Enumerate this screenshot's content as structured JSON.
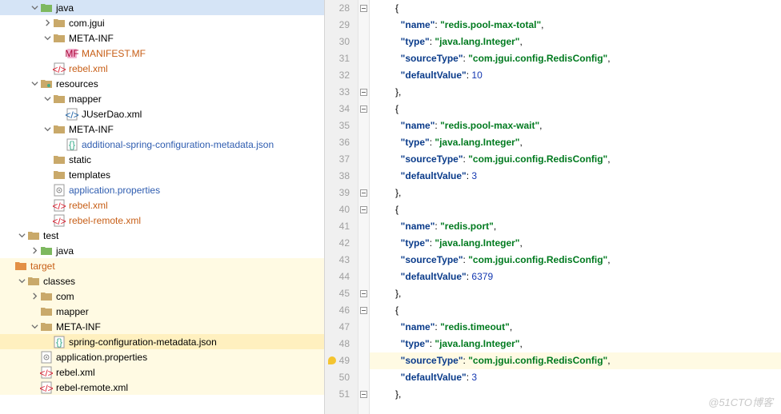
{
  "tree": [
    {
      "d": 2,
      "arr": "down",
      "icon": "folder-green",
      "label": "java",
      "cls": ""
    },
    {
      "d": 3,
      "arr": "right",
      "icon": "folder",
      "label": "com.jgui",
      "cls": ""
    },
    {
      "d": 3,
      "arr": "down",
      "icon": "folder",
      "label": "META-INF",
      "cls": ""
    },
    {
      "d": 4,
      "arr": "",
      "icon": "mf",
      "label": "MANIFEST.MF",
      "cls": "orange"
    },
    {
      "d": 3,
      "arr": "",
      "icon": "xml",
      "label": "rebel.xml",
      "cls": "orange"
    },
    {
      "d": 2,
      "arr": "down",
      "icon": "folder-res",
      "label": "resources",
      "cls": ""
    },
    {
      "d": 3,
      "arr": "down",
      "icon": "folder",
      "label": "mapper",
      "cls": ""
    },
    {
      "d": 4,
      "arr": "",
      "icon": "xml-b",
      "label": "JUserDao.xml",
      "cls": ""
    },
    {
      "d": 3,
      "arr": "down",
      "icon": "folder",
      "label": "META-INF",
      "cls": ""
    },
    {
      "d": 4,
      "arr": "",
      "icon": "json",
      "label": "additional-spring-configuration-metadata.json",
      "cls": "blue"
    },
    {
      "d": 3,
      "arr": "",
      "icon": "folder",
      "label": "static",
      "cls": ""
    },
    {
      "d": 3,
      "arr": "",
      "icon": "folder",
      "label": "templates",
      "cls": ""
    },
    {
      "d": 3,
      "arr": "",
      "icon": "props",
      "label": "application.properties",
      "cls": "blue"
    },
    {
      "d": 3,
      "arr": "",
      "icon": "xml",
      "label": "rebel.xml",
      "cls": "orange"
    },
    {
      "d": 3,
      "arr": "",
      "icon": "xml",
      "label": "rebel-remote.xml",
      "cls": "orange"
    },
    {
      "d": 1,
      "arr": "down",
      "icon": "folder",
      "label": "test",
      "cls": ""
    },
    {
      "d": 2,
      "arr": "right",
      "icon": "folder-green",
      "label": "java",
      "cls": ""
    },
    {
      "d": 0,
      "arr": "",
      "icon": "folder-out",
      "label": "target",
      "cls": "orange",
      "hl": true
    },
    {
      "d": 1,
      "arr": "down",
      "icon": "folder",
      "label": "classes",
      "cls": "",
      "hl": true
    },
    {
      "d": 2,
      "arr": "right",
      "icon": "folder",
      "label": "com",
      "cls": "",
      "hl": true
    },
    {
      "d": 2,
      "arr": "",
      "icon": "folder",
      "label": "mapper",
      "cls": "",
      "hl": true
    },
    {
      "d": 2,
      "arr": "down",
      "icon": "folder",
      "label": "META-INF",
      "cls": "",
      "hl": true
    },
    {
      "d": 3,
      "arr": "",
      "icon": "json",
      "label": "spring-configuration-metadata.json",
      "cls": "",
      "sel": true
    },
    {
      "d": 2,
      "arr": "",
      "icon": "props",
      "label": "application.properties",
      "cls": "",
      "hl": true
    },
    {
      "d": 2,
      "arr": "",
      "icon": "xml",
      "label": "rebel.xml",
      "cls": "",
      "hl": true
    },
    {
      "d": 2,
      "arr": "",
      "icon": "xml",
      "label": "rebel-remote.xml",
      "cls": "",
      "hl": true
    }
  ],
  "startLine": 28,
  "currentLine": 49,
  "foldMarks": {
    "28": "-",
    "29": "|",
    "30": "|",
    "31": "|",
    "32": "|",
    "33": "-",
    "34": "-",
    "35": "|",
    "36": "|",
    "37": "|",
    "38": "|",
    "39": "-",
    "40": "-",
    "41": "|",
    "42": "|",
    "43": "|",
    "44": "|",
    "45": "-",
    "46": "-",
    "47": "|",
    "48": "|",
    "49": "|",
    "50": "|",
    "51": "-"
  },
  "code": [
    [
      [
        "p",
        "      {"
      ]
    ],
    [
      [
        "p",
        "        "
      ],
      [
        "k",
        "\"name\""
      ],
      [
        "p",
        ": "
      ],
      [
        "s",
        "\"redis.pool-max-total\""
      ],
      [
        "p",
        ","
      ]
    ],
    [
      [
        "p",
        "        "
      ],
      [
        "k",
        "\"type\""
      ],
      [
        "p",
        ": "
      ],
      [
        "s",
        "\"java.lang.Integer\""
      ],
      [
        "p",
        ","
      ]
    ],
    [
      [
        "p",
        "        "
      ],
      [
        "k",
        "\"sourceType\""
      ],
      [
        "p",
        ": "
      ],
      [
        "s",
        "\"com.jgui.config.RedisConfig\""
      ],
      [
        "p",
        ","
      ]
    ],
    [
      [
        "p",
        "        "
      ],
      [
        "k",
        "\"defaultValue\""
      ],
      [
        "p",
        ": "
      ],
      [
        "n",
        "10"
      ]
    ],
    [
      [
        "p",
        "      },"
      ]
    ],
    [
      [
        "p",
        "      {"
      ]
    ],
    [
      [
        "p",
        "        "
      ],
      [
        "k",
        "\"name\""
      ],
      [
        "p",
        ": "
      ],
      [
        "s",
        "\"redis.pool-max-wait\""
      ],
      [
        "p",
        ","
      ]
    ],
    [
      [
        "p",
        "        "
      ],
      [
        "k",
        "\"type\""
      ],
      [
        "p",
        ": "
      ],
      [
        "s",
        "\"java.lang.Integer\""
      ],
      [
        "p",
        ","
      ]
    ],
    [
      [
        "p",
        "        "
      ],
      [
        "k",
        "\"sourceType\""
      ],
      [
        "p",
        ": "
      ],
      [
        "s",
        "\"com.jgui.config.RedisConfig\""
      ],
      [
        "p",
        ","
      ]
    ],
    [
      [
        "p",
        "        "
      ],
      [
        "k",
        "\"defaultValue\""
      ],
      [
        "p",
        ": "
      ],
      [
        "n",
        "3"
      ]
    ],
    [
      [
        "p",
        "      },"
      ]
    ],
    [
      [
        "p",
        "      {"
      ]
    ],
    [
      [
        "p",
        "        "
      ],
      [
        "k",
        "\"name\""
      ],
      [
        "p",
        ": "
      ],
      [
        "s",
        "\"redis.port\""
      ],
      [
        "p",
        ","
      ]
    ],
    [
      [
        "p",
        "        "
      ],
      [
        "k",
        "\"type\""
      ],
      [
        "p",
        ": "
      ],
      [
        "s",
        "\"java.lang.Integer\""
      ],
      [
        "p",
        ","
      ]
    ],
    [
      [
        "p",
        "        "
      ],
      [
        "k",
        "\"sourceType\""
      ],
      [
        "p",
        ": "
      ],
      [
        "s",
        "\"com.jgui.config.RedisConfig\""
      ],
      [
        "p",
        ","
      ]
    ],
    [
      [
        "p",
        "        "
      ],
      [
        "k",
        "\"defaultValue\""
      ],
      [
        "p",
        ": "
      ],
      [
        "n",
        "6379"
      ]
    ],
    [
      [
        "p",
        "      },"
      ]
    ],
    [
      [
        "p",
        "      {"
      ]
    ],
    [
      [
        "p",
        "        "
      ],
      [
        "k",
        "\"name\""
      ],
      [
        "p",
        ": "
      ],
      [
        "s",
        "\"redis.timeout\""
      ],
      [
        "p",
        ","
      ]
    ],
    [
      [
        "p",
        "        "
      ],
      [
        "k",
        "\"type\""
      ],
      [
        "p",
        ": "
      ],
      [
        "s",
        "\"java.lang.Integer\""
      ],
      [
        "p",
        ","
      ]
    ],
    [
      [
        "p",
        "        "
      ],
      [
        "k",
        "\"sourceType\""
      ],
      [
        "p",
        ": "
      ],
      [
        "s",
        "\"com.jgui.config.RedisConfig\""
      ],
      [
        "p",
        ","
      ]
    ],
    [
      [
        "p",
        "        "
      ],
      [
        "k",
        "\"defaultValue\""
      ],
      [
        "p",
        ": "
      ],
      [
        "n",
        "3"
      ]
    ],
    [
      [
        "p",
        "      },"
      ]
    ]
  ],
  "watermark": "@51CTO博客"
}
